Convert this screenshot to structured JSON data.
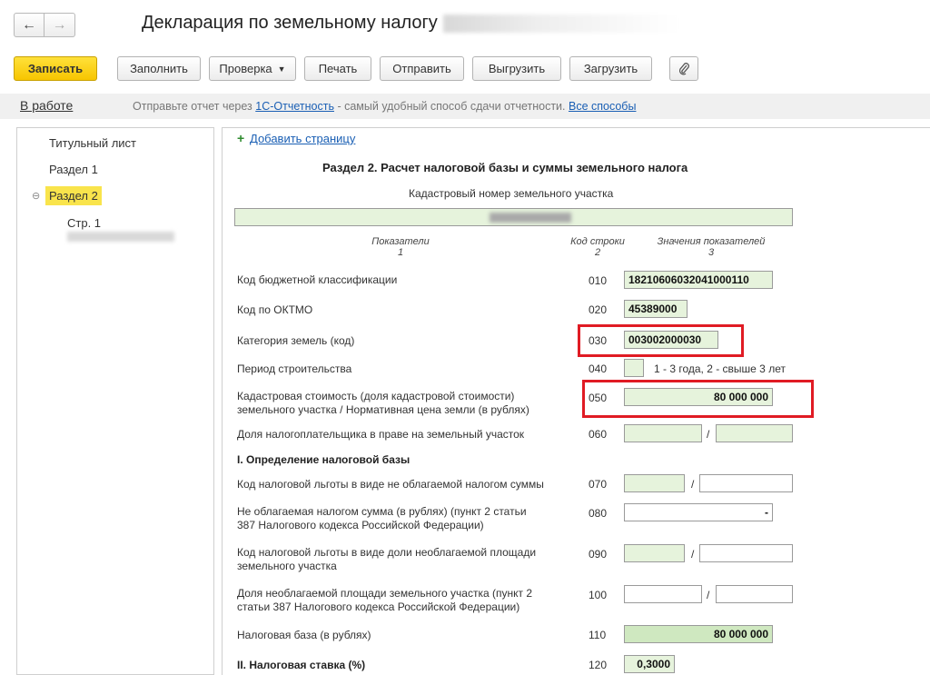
{
  "header": {
    "back_icon": "arrow-left-icon",
    "forward_icon": "arrow-right-icon",
    "title": "Декларация по земельному налогу"
  },
  "toolbar": {
    "save_label": "Записать",
    "fill_label": "Заполнить",
    "check_label": "Проверка",
    "print_label": "Печать",
    "send_label": "Отправить",
    "export_label": "Выгрузить",
    "import_label": "Загрузить",
    "attach_icon": "paperclip-icon"
  },
  "infobar": {
    "status": "В работе",
    "text_before": "Отправьте отчет через ",
    "link1": "1С-Отчетность",
    "text_middle": " - самый удобный способ сдачи отчетности. ",
    "link2": "Все способы"
  },
  "tree": {
    "items": [
      {
        "label": "Титульный лист"
      },
      {
        "label": "Раздел 1"
      },
      {
        "label": "Раздел 2"
      },
      {
        "label": "Стр. 1"
      }
    ]
  },
  "form": {
    "add_page": "Добавить страницу",
    "section_title": "Раздел 2. Расчет налоговой базы и суммы земельного налога",
    "cadastral_label": "Кадастровый номер земельного участка",
    "columns": {
      "indicators": "Показатели",
      "indicators_num": "1",
      "code": "Код строки",
      "code_num": "2",
      "values": "Значения показателей",
      "values_num": "3"
    },
    "rows": {
      "r010": {
        "label": "Код бюджетной классификации",
        "code": "010",
        "value": "18210606032041000110"
      },
      "r020": {
        "label": "Код по ОКТМО",
        "code": "020",
        "value": "45389000"
      },
      "r030": {
        "label": "Категория земель (код)",
        "code": "030",
        "value": "003002000030"
      },
      "r040": {
        "label": "Период строительства",
        "code": "040",
        "hint": "1 - 3 года, 2 - свыше 3 лет"
      },
      "r050": {
        "label_line1": "Кадастровая стоимость (доля кадастровой стоимости)",
        "label_line2": "земельного участка / Нормативная цена земли (в рублях)",
        "code": "050",
        "value": "80 000 000"
      },
      "r060": {
        "label": "Доля налогоплательщика в праве на земельный участок",
        "code": "060"
      },
      "subhead1": "I. Определение налоговой базы",
      "r070": {
        "label": "Код налоговой льготы в виде не облагаемой налогом суммы",
        "code": "070"
      },
      "r080": {
        "label_line1": "Не облагаемая налогом сумма (в рублях) (пункт 2 статьи",
        "label_line2": "387 Налогового кодекса Российской Федерации)",
        "code": "080",
        "value": "-"
      },
      "r090": {
        "label_line1": "Код налоговой льготы в виде доли необлагаемой площади",
        "label_line2": "земельного участка",
        "code": "090"
      },
      "r100": {
        "label_line1": "Доля необлагаемой площади земельного участка (пункт 2",
        "label_line2": "статьи 387 Налогового кодекса Российской Федерации)",
        "code": "100"
      },
      "r110": {
        "label": "Налоговая база (в рублях)",
        "code": "110",
        "value": "80 000 000"
      },
      "r120": {
        "label": "II. Налоговая ставка (%)",
        "code": "120",
        "value": "0,3000"
      }
    },
    "slash": "/",
    "highlight_color": "#e01b24"
  }
}
